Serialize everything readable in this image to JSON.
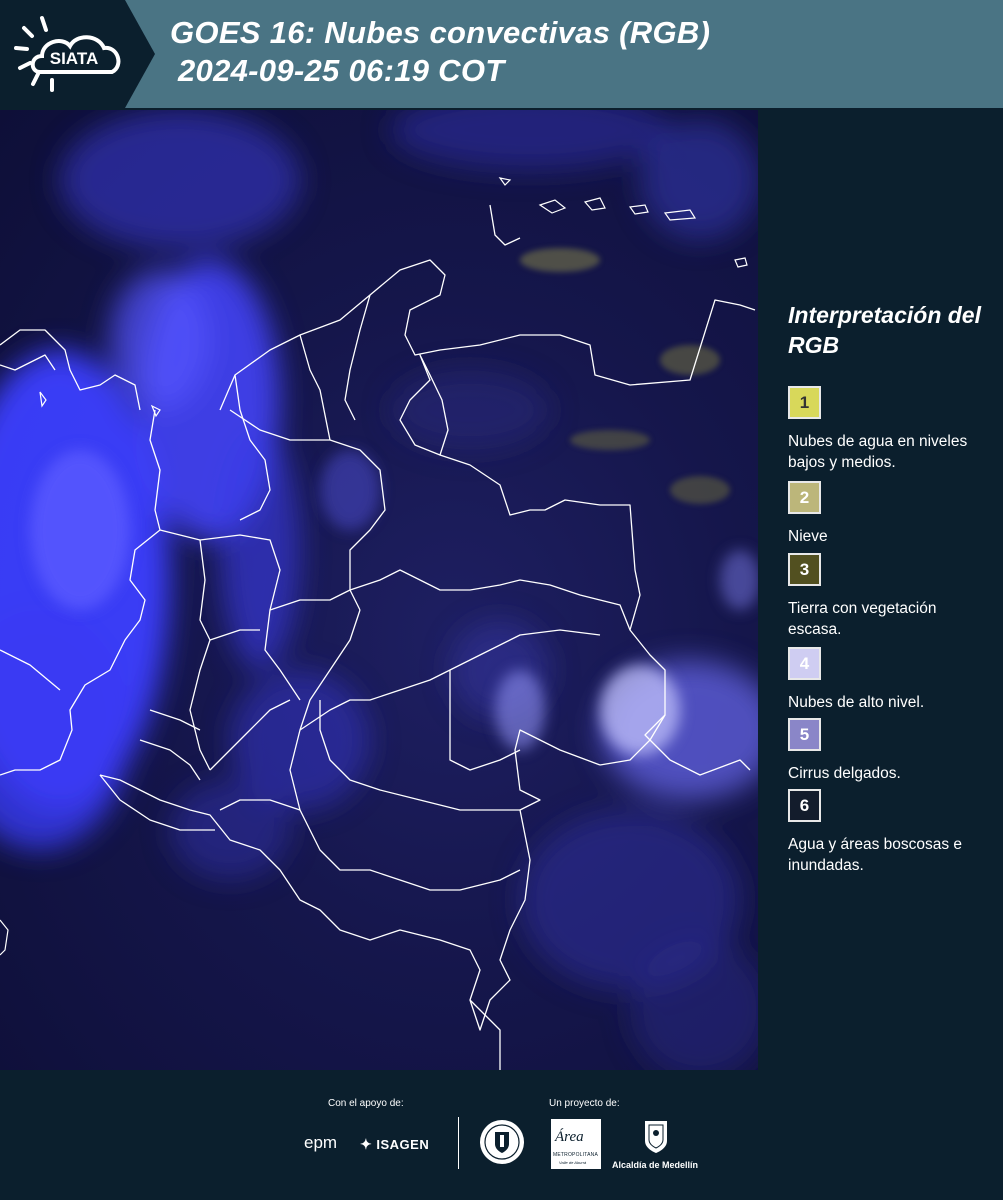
{
  "header": {
    "logo_text": "SIATA",
    "title_line1": "GOES 16: Nubes convectivas (RGB)",
    "title_line2": "2024-09-25 06:19 COT"
  },
  "legend": {
    "title": "Interpretación del RGB",
    "items": [
      {
        "number": "1",
        "label": "Nubes de agua en niveles bajos y medios.",
        "color": "#d8d85a",
        "text_color": "#333333"
      },
      {
        "number": "2",
        "label": "Nieve",
        "color": "#bcb67a",
        "text_color": "#ffffff"
      },
      {
        "number": "3",
        "label": "Tierra con vegetación escasa.",
        "color": "#525020",
        "text_color": "#ffffff"
      },
      {
        "number": "4",
        "label": "Nubes de alto nivel.",
        "color": "#cfcdf2",
        "text_color": "#ffffff"
      },
      {
        "number": "5",
        "label": "Cirrus delgados.",
        "color": "#8a86c8",
        "text_color": "#ffffff"
      },
      {
        "number": "6",
        "label": "Agua y áreas boscosas e inundadas.",
        "color": "#131c2c",
        "text_color": "#ffffff"
      }
    ]
  },
  "footer": {
    "support_label": "Con el apoyo de:",
    "project_label": "Un proyecto de:",
    "sponsor_epm": "epm",
    "sponsor_isagen": "ISAGEN",
    "partner_area": "Área",
    "partner_area_sub": "METROPOLITANA",
    "partner_area_sub2": "Valle de Aburrá",
    "partner_alcaldia": "Alcaldía de Medellín"
  },
  "colors": {
    "header_bg": "#4a7484",
    "page_bg": "#0b1f2d",
    "map_bg": "#15164b",
    "cloud_blue": "#4b4cff"
  }
}
